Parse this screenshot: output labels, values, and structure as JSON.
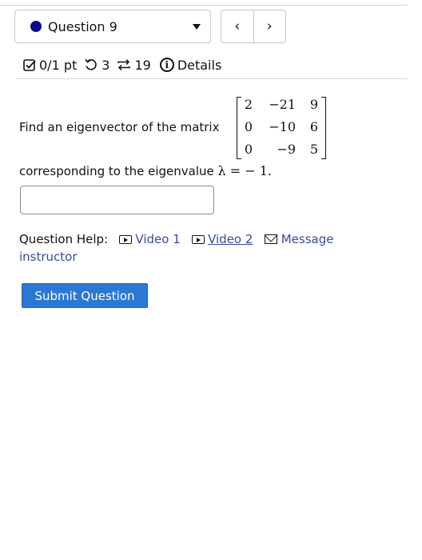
{
  "question_nav": {
    "label": "Question 9",
    "prev_symbol": "‹",
    "next_symbol": "›",
    "dot_color": "#0b0b8c"
  },
  "stats": {
    "points": "0/1 pt",
    "retries": "3",
    "attempts": "19",
    "details": "Details"
  },
  "problem": {
    "prompt": "Find an eigenvector of the matrix",
    "matrix": [
      [
        "2",
        "−21",
        "9"
      ],
      [
        "0",
        "−10",
        "6"
      ],
      [
        "0",
        "−9",
        "5"
      ]
    ],
    "line2_text": "corresponding to the eigenvalue",
    "line2_math": "λ = − 1."
  },
  "answer": {
    "value": ""
  },
  "help": {
    "label": "Question Help:",
    "video1": "Video 1",
    "video2": "Video 2",
    "message": "Message",
    "message_cont": "instructor"
  },
  "submit": {
    "label": "Submit Question",
    "color": "#2b78d4"
  }
}
